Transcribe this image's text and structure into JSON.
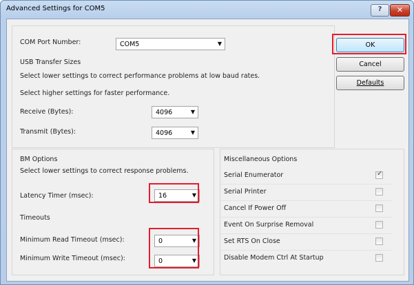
{
  "window": {
    "title": "Advanced Settings for COM5",
    "help_glyph": "?",
    "close_glyph": "✕"
  },
  "com_port": {
    "label": "COM Port Number:",
    "value": "COM5"
  },
  "usb_transfer": {
    "title": "USB Transfer Sizes",
    "desc1": "Select lower settings to correct performance problems at low baud rates.",
    "desc2": "Select higher settings for faster performance.",
    "receive_label": "Receive (Bytes):",
    "receive_value": "4096",
    "transmit_label": "Transmit (Bytes):",
    "transmit_value": "4096"
  },
  "bm_options": {
    "title": "BM Options",
    "desc": "Select lower settings to correct response problems.",
    "latency_label": "Latency Timer (msec):",
    "latency_value": "16"
  },
  "timeouts": {
    "title": "Timeouts",
    "min_read_label": "Minimum Read Timeout (msec):",
    "min_read_value": "0",
    "min_write_label": "Minimum Write Timeout (msec):",
    "min_write_value": "0"
  },
  "misc_options": {
    "title": "Miscellaneous Options",
    "items": [
      {
        "label": "Serial Enumerator",
        "checked": true
      },
      {
        "label": "Serial Printer",
        "checked": false
      },
      {
        "label": "Cancel If Power Off",
        "checked": false
      },
      {
        "label": "Event On Surprise Removal",
        "checked": false
      },
      {
        "label": "Set RTS On Close",
        "checked": false
      },
      {
        "label": "Disable Modem Ctrl At Startup",
        "checked": false
      }
    ]
  },
  "buttons": {
    "ok": "OK",
    "cancel": "Cancel",
    "defaults": "Defaults"
  },
  "arrow_glyph": "▼",
  "check_glyph": "✓",
  "colors": {
    "highlight": "#e41c2d",
    "title_bar": "#b9d0ec",
    "dialog_bg": "#f0f0f0"
  }
}
